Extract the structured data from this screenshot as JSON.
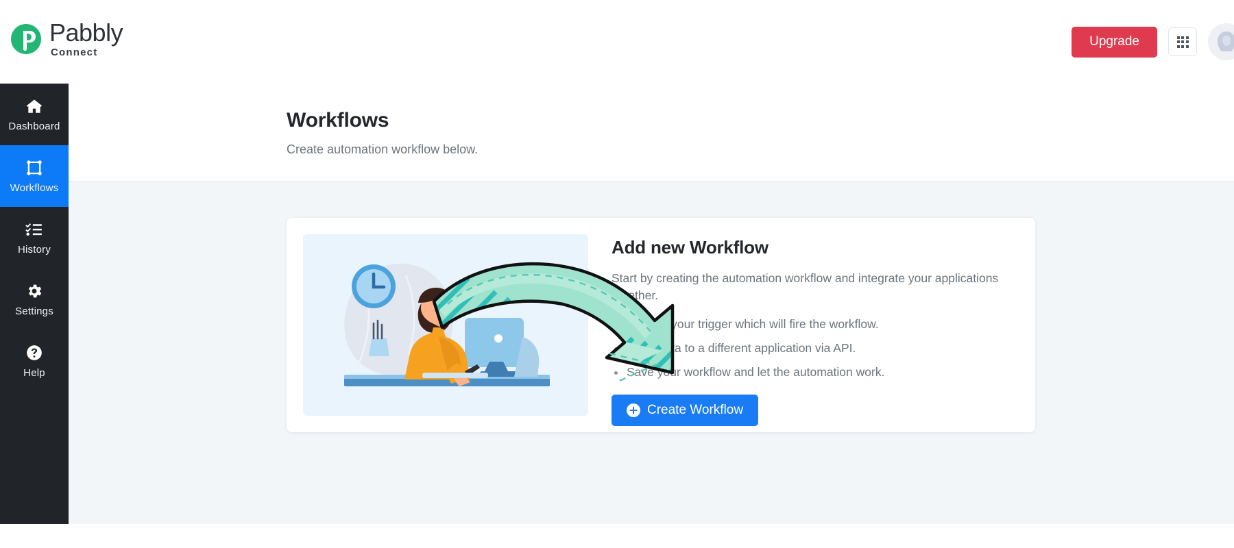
{
  "brand": {
    "name": "Pabbly",
    "product": "Connect",
    "mark_color": "#22b573"
  },
  "topbar": {
    "upgrade_label": "Upgrade",
    "apps_icon": "grid-apps-icon",
    "avatar_icon": "user-avatar",
    "upgrade_color": "#e03a4e"
  },
  "sidebar": {
    "active_color": "#0d7bf7",
    "background_color": "#212529",
    "items": [
      {
        "label": "Dashboard",
        "icon": "home-icon",
        "active": false
      },
      {
        "label": "Workflows",
        "icon": "workflow-nodes-icon",
        "active": true
      },
      {
        "label": "History",
        "icon": "checklist-icon",
        "active": false
      },
      {
        "label": "Settings",
        "icon": "gear-icon",
        "active": false
      },
      {
        "label": "Help",
        "icon": "question-circle-icon",
        "active": false
      }
    ]
  },
  "page": {
    "title": "Workflows",
    "subtitle": "Create automation workflow below."
  },
  "card": {
    "title": "Add new Workflow",
    "description": "Start by creating the automation workflow and integrate your applications together.",
    "bullets": [
      "Choose your trigger which will fire the workflow.",
      "Send data to a different application via API.",
      "Save your workflow and let the automation work."
    ],
    "create_button_label": "Create Workflow",
    "create_button_icon": "plus-circle-icon",
    "create_button_color": "#1a7cf5",
    "illustration": "person-at-desk-with-arrow-illustration"
  }
}
